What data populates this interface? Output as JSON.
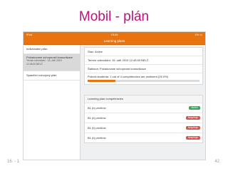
{
  "slide": {
    "title": "Mobil - plán",
    "footer_left": "16. - 1",
    "page_number": "42"
  },
  "status_bar": {
    "left": "iPad",
    "time": "15:34",
    "right": "1% ▭"
  },
  "nav": {
    "title": "Learning plans"
  },
  "sidebar": {
    "items": [
      {
        "label": "Individuální plán:",
        "sub": []
      },
      {
        "label": "Požadované schopnosti komunikace",
        "sub": [
          "Termín odevzdání : 15. září 2019",
          "12:45:00 BELČ"
        ]
      },
      {
        "label": "Spanělní rozvojový plán",
        "sub": []
      }
    ]
  },
  "details": {
    "status": "Stav: Active",
    "due": "Termín odevzdání: 15. září 2019 12:45:00 BELČ",
    "template": "Šablona: Požadované schopnosti komunikace",
    "progress_text": "Pokrok studenta: 1 out of 4 competencies are proficient (25.0%)",
    "progress_fraction": 0.25
  },
  "competencies": {
    "header": "Learning plan competencies",
    "items": [
      {
        "label": "B1 (b) změlnív",
        "badge": "Aktivní",
        "color": "#3aa557"
      },
      {
        "label": "B1 (b) změlnív",
        "badge": "Nesplňuje",
        "color": "#d9534f"
      },
      {
        "label": "B1 (b) změlnív",
        "badge": "Nesplňuje",
        "color": "#d9534f"
      },
      {
        "label": "B1 (b) změlnív",
        "badge": "Nesplňuje",
        "color": "#d9534f"
      }
    ]
  },
  "colors": {
    "accent": "#e8730f",
    "title": "#c0107c"
  }
}
